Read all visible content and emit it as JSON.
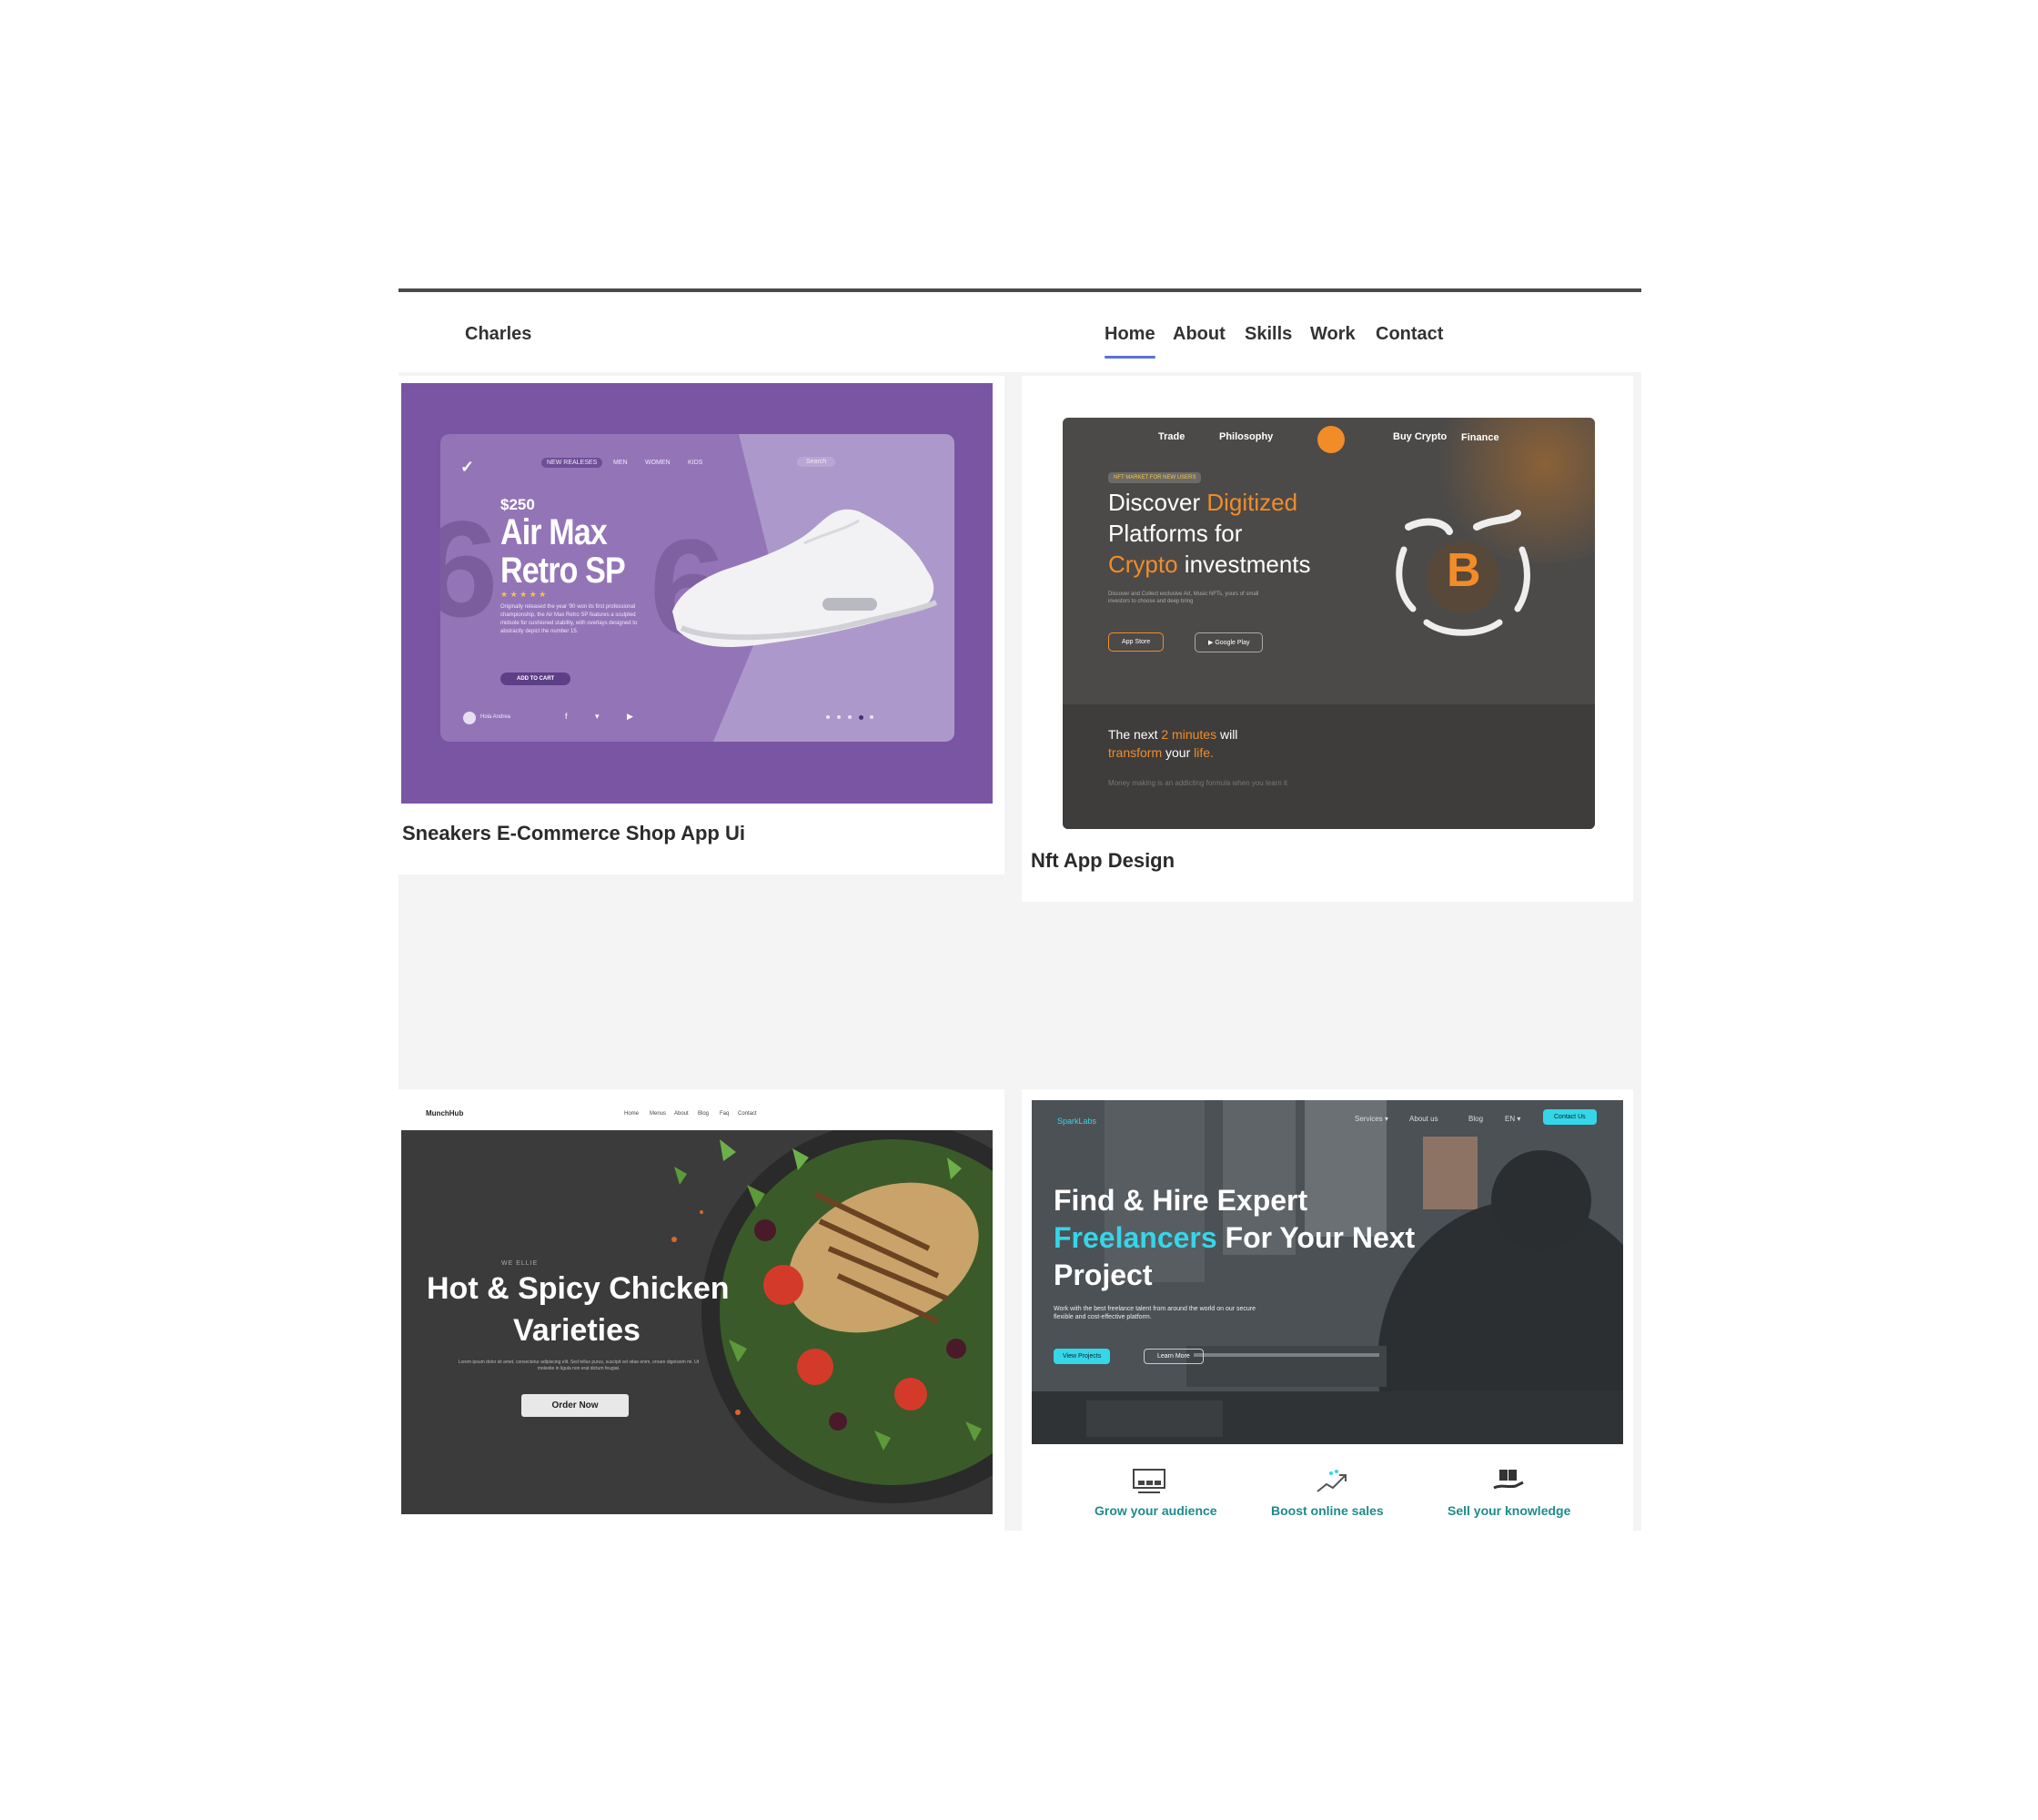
{
  "nav": {
    "brand": "Charles",
    "items": [
      {
        "label": "Home",
        "active": true
      },
      {
        "label": "About"
      },
      {
        "label": "Skills"
      },
      {
        "label": "Work"
      },
      {
        "label": "Contact"
      }
    ]
  },
  "projects": [
    {
      "title": "Sneakers E-Commerce Shop App Ui",
      "preview": {
        "nav": [
          "NEW REALESES",
          "MEN",
          "WOMEN",
          "KIDS"
        ],
        "search_placeholder": "Search",
        "price": "$250",
        "headline_1": "Air Max",
        "headline_2": "Retro SP",
        "stars": "★ ★ ★ ★ ★",
        "body": "Originally released the year '90 won its first professional championship, the Air Max Retro SP features a sculpted midsole for cushioned stability, with overlays designed to abstractly depict the number 15.",
        "button": "ADD TO CART",
        "user": "Hola Andrea",
        "accent": "#7a55a3"
      }
    },
    {
      "title": "Nft App Design",
      "preview": {
        "nav": [
          "Trade",
          "Philosophy",
          "Buy Crypto",
          "Finance"
        ],
        "tag": "NFT MARKET FOR NEW USERS",
        "headline_1a": "Discover ",
        "headline_1b": "Digitized",
        "headline_2": "Platforms for",
        "headline_3a": "Crypto",
        "headline_3b": " investments",
        "body": "Discover and Collect exclusive Art, Music NFTs, yours of small investors to choose and deep bring",
        "store_1": "App Store",
        "store_2": "Google Play",
        "coin": "B",
        "lower_1a": "The next ",
        "lower_1b": "2 minutes",
        "lower_1c": " will",
        "lower_2a": "transform",
        "lower_2b": " your ",
        "lower_2c": "life.",
        "lower_body": "Money making is an addicting formula when you learn it",
        "accent": "#f28c28"
      }
    },
    {
      "title": "",
      "preview": {
        "brand": "MunchHub",
        "nav": [
          "Home",
          "Menus",
          "About",
          "Blog",
          "Faq",
          "Contact"
        ],
        "eyebrow": "WE ELLIE",
        "headline_1": "Hot & Spicy Chicken",
        "headline_2": "Varieties",
        "body": "Lorem ipsum dolor sit amet, consectetur adipiscing elit. Sed tellus purus, suscipit vel vitae enim, ornare dignissim mi. Ut molestie in ligula non erat dictum feugiat.",
        "button": "Order Now"
      }
    },
    {
      "title": "",
      "preview": {
        "brand": "SparkLabs",
        "nav": [
          "Services ▾",
          "About us",
          "Blog",
          "EN ▾"
        ],
        "contact": "Contact Us",
        "headline_1": "Find & Hire Expert",
        "headline_2a": "Freelancers",
        "headline_2b": " For Your Next",
        "headline_3": "Project",
        "body": "Work with the best freelance talent from around the world on our secure flexible and cost-effective platform.",
        "btn_1": "View Projects",
        "btn_2": "Learn More",
        "features": [
          "Grow your audience",
          "Boost online sales",
          "Sell your knowledge"
        ],
        "accent": "#35d6e8"
      }
    }
  ]
}
